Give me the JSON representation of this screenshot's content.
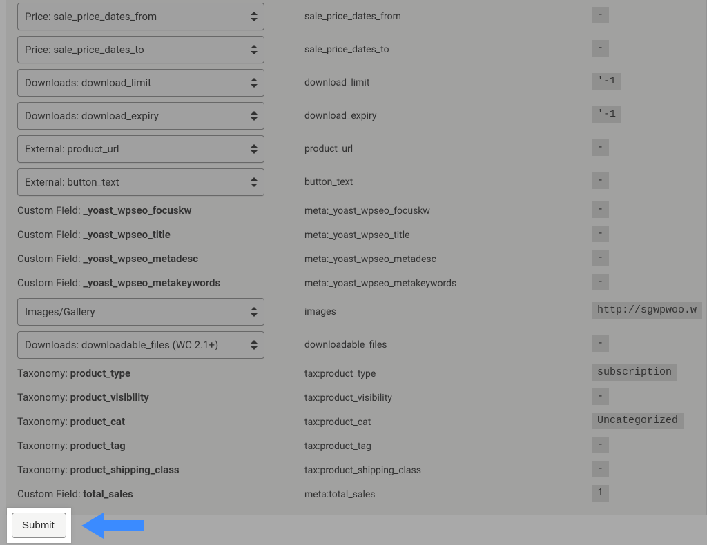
{
  "rows": [
    {
      "type": "select",
      "select_label": "Price: sale_price_dates_from",
      "field": "sale_price_dates_from",
      "sample": "-"
    },
    {
      "type": "select",
      "select_label": "Price: sale_price_dates_to",
      "field": "sale_price_dates_to",
      "sample": "-"
    },
    {
      "type": "select",
      "select_label": "Downloads: download_limit",
      "field": "download_limit",
      "sample": "'-1"
    },
    {
      "type": "select",
      "select_label": "Downloads: download_expiry",
      "field": "download_expiry",
      "sample": "'-1"
    },
    {
      "type": "select",
      "select_label": "External: product_url",
      "field": "product_url",
      "sample": "-"
    },
    {
      "type": "select",
      "select_label": "External: button_text",
      "field": "button_text",
      "sample": "-"
    },
    {
      "type": "static",
      "prefix": "Custom Field: ",
      "bold": "_yoast_wpseo_focuskw",
      "field": "meta:_yoast_wpseo_focuskw",
      "sample": "-"
    },
    {
      "type": "static",
      "prefix": "Custom Field: ",
      "bold": "_yoast_wpseo_title",
      "field": "meta:_yoast_wpseo_title",
      "sample": "-"
    },
    {
      "type": "static",
      "prefix": "Custom Field: ",
      "bold": "_yoast_wpseo_metadesc",
      "field": "meta:_yoast_wpseo_metadesc",
      "sample": "-"
    },
    {
      "type": "static",
      "prefix": "Custom Field: ",
      "bold": "_yoast_wpseo_metakeywords",
      "field": "meta:_yoast_wpseo_metakeywords",
      "sample": "-"
    },
    {
      "type": "select",
      "select_label": "Images/Gallery",
      "field": "images",
      "sample": "http://sgwpwoo.w"
    },
    {
      "type": "select",
      "select_label": "Downloads: downloadable_files (WC 2.1+)",
      "field": "downloadable_files",
      "sample": "-"
    },
    {
      "type": "static",
      "prefix": "Taxonomy: ",
      "bold": "product_type",
      "field": "tax:product_type",
      "sample": "subscription"
    },
    {
      "type": "static",
      "prefix": "Taxonomy: ",
      "bold": "product_visibility",
      "field": "tax:product_visibility",
      "sample": "-"
    },
    {
      "type": "static",
      "prefix": "Taxonomy: ",
      "bold": "product_cat",
      "field": "tax:product_cat",
      "sample": "Uncategorized"
    },
    {
      "type": "static",
      "prefix": "Taxonomy: ",
      "bold": "product_tag",
      "field": "tax:product_tag",
      "sample": "-"
    },
    {
      "type": "static",
      "prefix": "Taxonomy: ",
      "bold": "product_shipping_class",
      "field": "tax:product_shipping_class",
      "sample": "-"
    },
    {
      "type": "static",
      "prefix": "Custom Field: ",
      "bold": "total_sales",
      "field": "meta:total_sales",
      "sample": "1"
    }
  ],
  "submit": {
    "label": "Submit"
  },
  "icons": {
    "sort": "sort-icon"
  },
  "colors": {
    "arrow": "#3b8bff"
  }
}
